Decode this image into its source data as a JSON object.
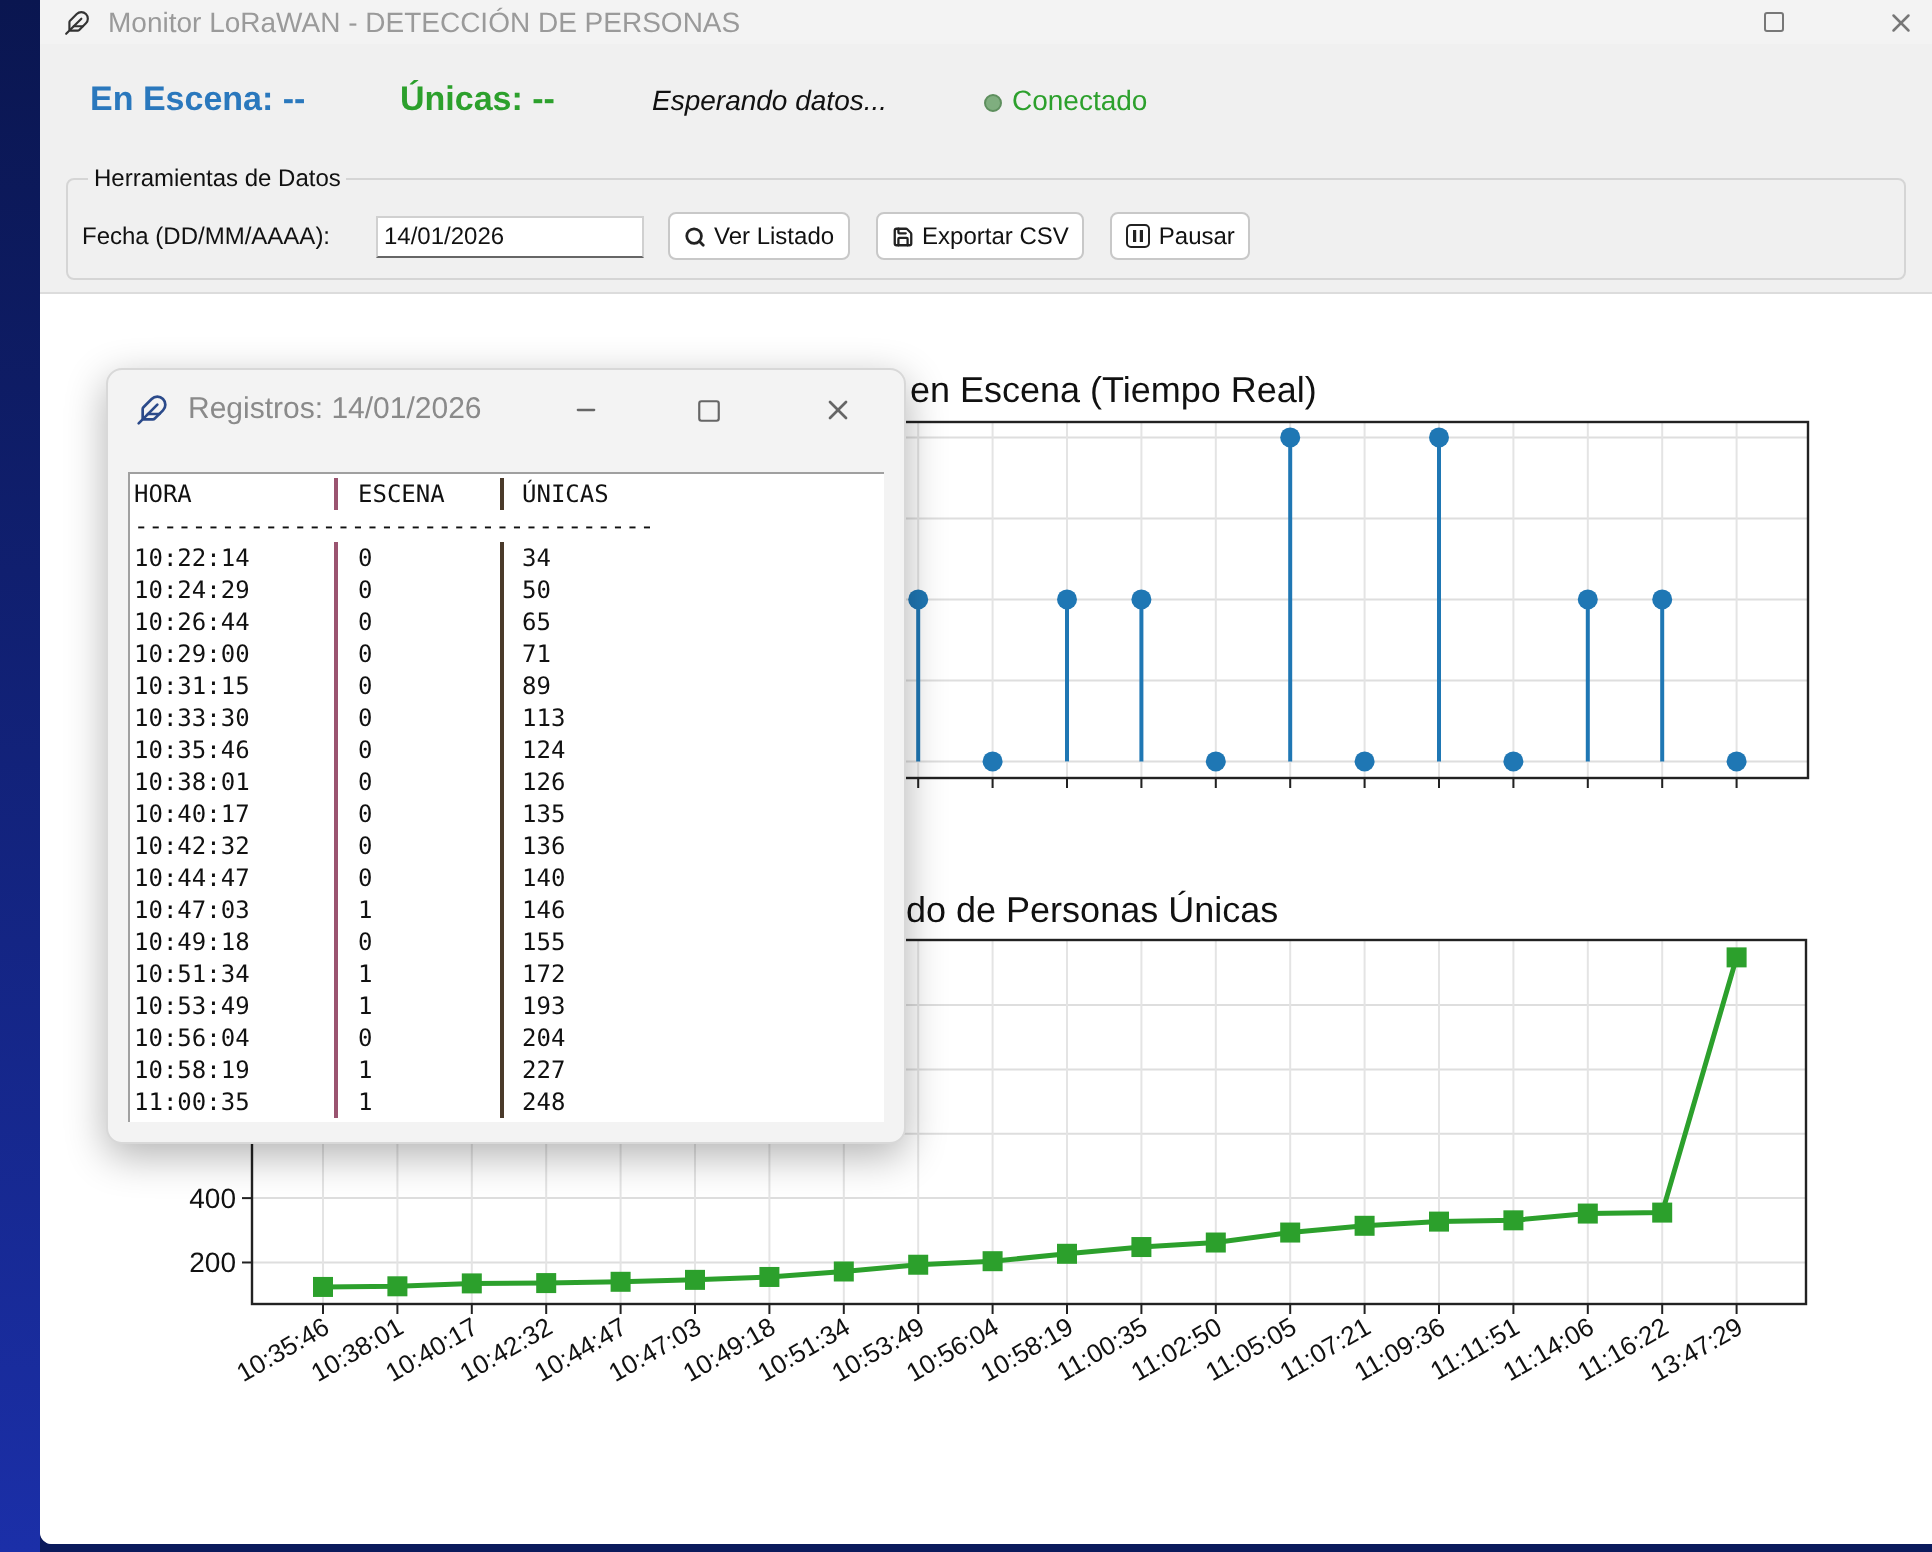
{
  "window": {
    "title": "Monitor LoRaWAN - DETECCIÓN DE PERSONAS"
  },
  "status": {
    "scene": "En Escena: --",
    "unique": "Únicas: --",
    "message": "Esperando datos...",
    "connection": "Conectado"
  },
  "tools": {
    "title": "Herramientas de Datos",
    "date_label": "Fecha (DD/MM/AAAA):",
    "date_value": "14/01/2026",
    "buttons": [
      {
        "label": "Ver Listado",
        "kind": "search"
      },
      {
        "label": "Exportar CSV",
        "kind": "save"
      },
      {
        "label": "Pausar",
        "kind": "pause"
      }
    ]
  },
  "charts": [
    {
      "title": "en Escena (Tiempo Real)"
    },
    {
      "title": "do de Personas Únicas",
      "chart_data": {
        "type": "line",
        "categories": [
          "10:35:46",
          "10:38:01",
          "10:40:17",
          "10:42:32",
          "10:44:47",
          "10:47:03",
          "10:49:18",
          "10:51:34",
          "10:53:49",
          "10:56:04",
          "10:58:19",
          "11:00:35",
          "11:02:50",
          "11:05:05",
          "11:07:21",
          "11:09:36",
          "11:11:51",
          "11:14:06",
          "11:16:22",
          "13:47:29"
        ],
        "grid": true,
        "series": [
          {
            "color": "#2ca02c",
            "marker": "s",
            "values": [
              124,
              126,
              135,
              136,
              140,
              146,
              155,
              172,
              193,
              204,
              227,
              248,
              262,
              293,
              314,
              327,
              331,
              352,
              355,
              1148
            ]
          }
        ],
        "ylim": [
          71,
          1202
        ],
        "yticks": [
          200,
          400
        ]
      }
    }
  ],
  "records_window": {
    "title": "Registros: 14/01/2026",
    "header": [
      "HORA",
      "ESCENA",
      "ÚNICAS"
    ],
    "divider": "------------------------------------",
    "rows": [
      [
        "10:22:14",
        "0",
        "34"
      ],
      [
        "10:24:29",
        "0",
        "50"
      ],
      [
        "10:26:44",
        "0",
        "65"
      ],
      [
        "10:29:00",
        "0",
        "71"
      ],
      [
        "10:31:15",
        "0",
        "89"
      ],
      [
        "10:33:30",
        "0",
        "113"
      ],
      [
        "10:35:46",
        "0",
        "124"
      ],
      [
        "10:38:01",
        "0",
        "126"
      ],
      [
        "10:40:17",
        "0",
        "135"
      ],
      [
        "10:42:32",
        "0",
        "136"
      ],
      [
        "10:44:47",
        "0",
        "140"
      ],
      [
        "10:47:03",
        "1",
        "146"
      ],
      [
        "10:49:18",
        "0",
        "155"
      ],
      [
        "10:51:34",
        "1",
        "172"
      ],
      [
        "10:53:49",
        "1",
        "193"
      ],
      [
        "10:56:04",
        "0",
        "204"
      ],
      [
        "10:58:19",
        "1",
        "227"
      ],
      [
        "11:00:35",
        "1",
        "248"
      ]
    ]
  }
}
